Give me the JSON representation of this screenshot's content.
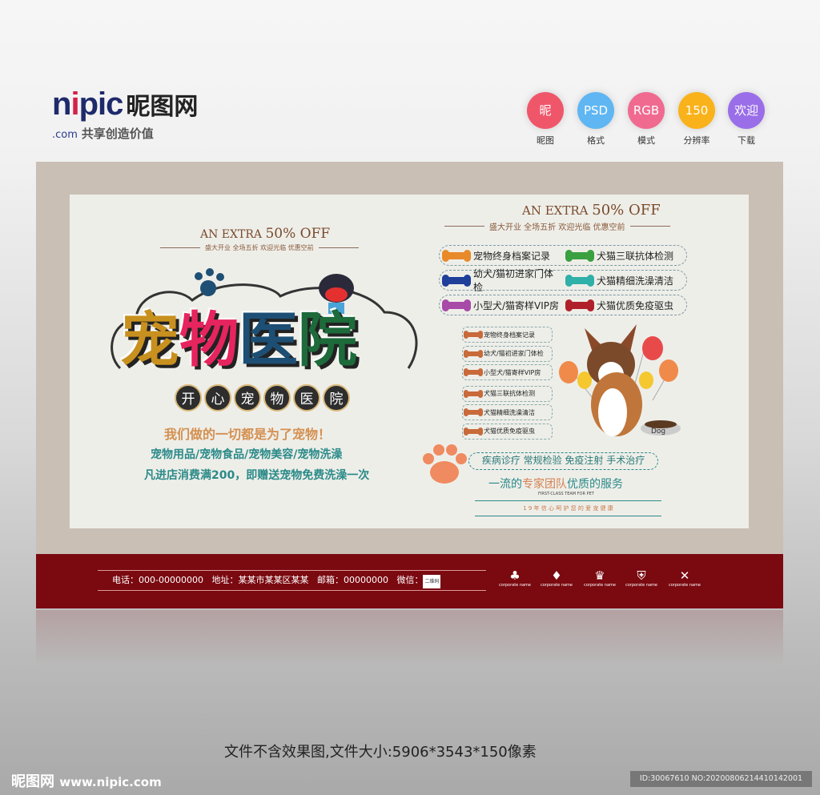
{
  "logo": {
    "brand_latin_1": "n",
    "brand_i": "i",
    "brand_latin_2": "pic",
    "brand_cn": "昵图网",
    "domain": ".com",
    "tagline": "共享创造价值"
  },
  "badges": [
    {
      "icon": "昵",
      "label": "昵图",
      "color": "#f0566a"
    },
    {
      "icon": "PSD",
      "label": "格式",
      "color": "#5fb6f2"
    },
    {
      "icon": "RGB",
      "label": "模式",
      "color": "#f06a90"
    },
    {
      "icon": "150",
      "label": "分辨率",
      "color": "#f9b21a"
    },
    {
      "icon": "欢迎",
      "label": "下载",
      "color": "#9a6ee8"
    }
  ],
  "left": {
    "offer_a": "AN EXTRA ",
    "offer_b": "50% OFF",
    "sub": "盛大开业 全场五折 欢迎光临 优惠空前",
    "title": [
      {
        "ch": "宠",
        "color": "#c8901e"
      },
      {
        "ch": "物",
        "color": "#e6245e"
      },
      {
        "ch": "医",
        "color": "#1d4f74"
      },
      {
        "ch": "院",
        "color": "#1d6a3a"
      }
    ],
    "circles": [
      "开",
      "心",
      "宠",
      "物",
      "医",
      "院"
    ],
    "slogan": "我们做的一切都是为了宠物！",
    "line1": "宠物用品/宠物食品/宠物美容/宠物洗澡",
    "line2": "凡进店消费满200，即赠送宠物免费洗澡一次"
  },
  "right": {
    "offer_a": "AN EXTRA ",
    "offer_b": "50% OFF",
    "sub": "盛大开业 全场五折 欢迎光临 优惠空前",
    "pills": [
      [
        {
          "text": "宠物终身档案记录",
          "color": "#e88a2a"
        },
        {
          "text": "犬猫三联抗体检测",
          "color": "#3aa040"
        }
      ],
      [
        {
          "text": "幼犬/猫初进家门体检",
          "color": "#1e3f9a"
        },
        {
          "text": "犬猫精细洗澡清洁",
          "color": "#2fb0a8"
        }
      ],
      [
        {
          "text": "小型犬/猫寄样VIP房",
          "color": "#a84aa8"
        },
        {
          "text": "犬猫优质免疫驱虫",
          "color": "#b0202a"
        }
      ]
    ],
    "small_list": [
      "宠物终身档案记录",
      "幼犬/猫初进家门体检",
      "小型犬/猫寄样VIP房",
      "犬猫三联抗体检测",
      "犬猫精细洗澡清洁",
      "犬猫优质免疫驱虫"
    ],
    "dog_bowl": "Dog",
    "services": "疾病诊疗 常规检验 免疫注射 手术治疗",
    "team_a": "一流的",
    "team_b": "专家团队",
    "team_c": "优质的服务",
    "team_en": "FIRST-CLASS TEAM FOR PET",
    "motto": "1 9 年 信 心 呵 护 您 的 爱 宠 健 康"
  },
  "footer": {
    "phone": "电话：000-00000000",
    "address": "地址：某某市某某区某某",
    "email": "邮箱：00000000",
    "wechat": "微信：",
    "qr": "二维码",
    "corp": [
      {
        "icon": "tree-icon",
        "glyph": "♣",
        "label": "corporate name"
      },
      {
        "icon": "diamond-icon",
        "glyph": "♦",
        "label": "corporate name"
      },
      {
        "icon": "crown-icon",
        "glyph": "♛",
        "label": "corporate name"
      },
      {
        "icon": "shield-icon",
        "glyph": "⛨",
        "label": "corporate name"
      },
      {
        "icon": "network-icon",
        "glyph": "✕",
        "label": "corporate name"
      }
    ]
  },
  "caption": "文件不含效果图,文件大小:5906*3543*150像素",
  "bottom": {
    "logo": "昵图网",
    "url": "www.nipic.com",
    "id": "ID:30067610 NO:20200806214410142001"
  }
}
